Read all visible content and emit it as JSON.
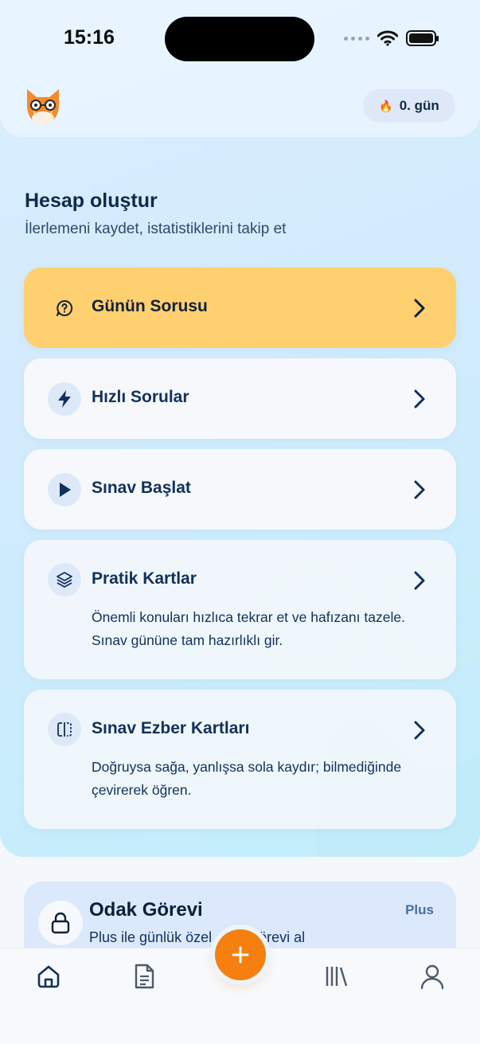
{
  "status_bar": {
    "time": "15:16"
  },
  "header": {
    "streak_label": "0. gün",
    "avatar_icon": "fox-mascot-icon"
  },
  "intro": {
    "title": "Hesap oluştur",
    "subtitle": "İlerlemeni kaydet, istatistiklerini takip et"
  },
  "menu": [
    {
      "label": "Günün Sorusu",
      "icon": "question-bubble-icon"
    },
    {
      "label": "Hızlı Sorular",
      "icon": "lightning-icon"
    },
    {
      "label": "Sınav Başlat",
      "icon": "play-icon"
    },
    {
      "label": "Pratik Kartlar",
      "icon": "layers-icon",
      "description": "Önemli konuları hızlıca tekrar et ve hafızanı tazele. Sınav gününe tam hazırlıklı gir."
    },
    {
      "label": "Sınav Ezber Kartları",
      "icon": "flip-cards-icon",
      "description": "Doğruysa sağa, yanlışsa sola kaydır; bilmediğinde çevirerek öğren."
    }
  ],
  "focus_task": {
    "title": "Odak Görevi",
    "badge": "Plus",
    "subtitle": "Plus ile günlük özel odak görevi al"
  },
  "tabbar": {
    "items": [
      "home-icon",
      "document-icon",
      "add-icon",
      "library-icon",
      "profile-icon"
    ]
  },
  "colors": {
    "accent": "#F5800F",
    "daily_card": "#FED06F",
    "navy": "#10315A"
  }
}
